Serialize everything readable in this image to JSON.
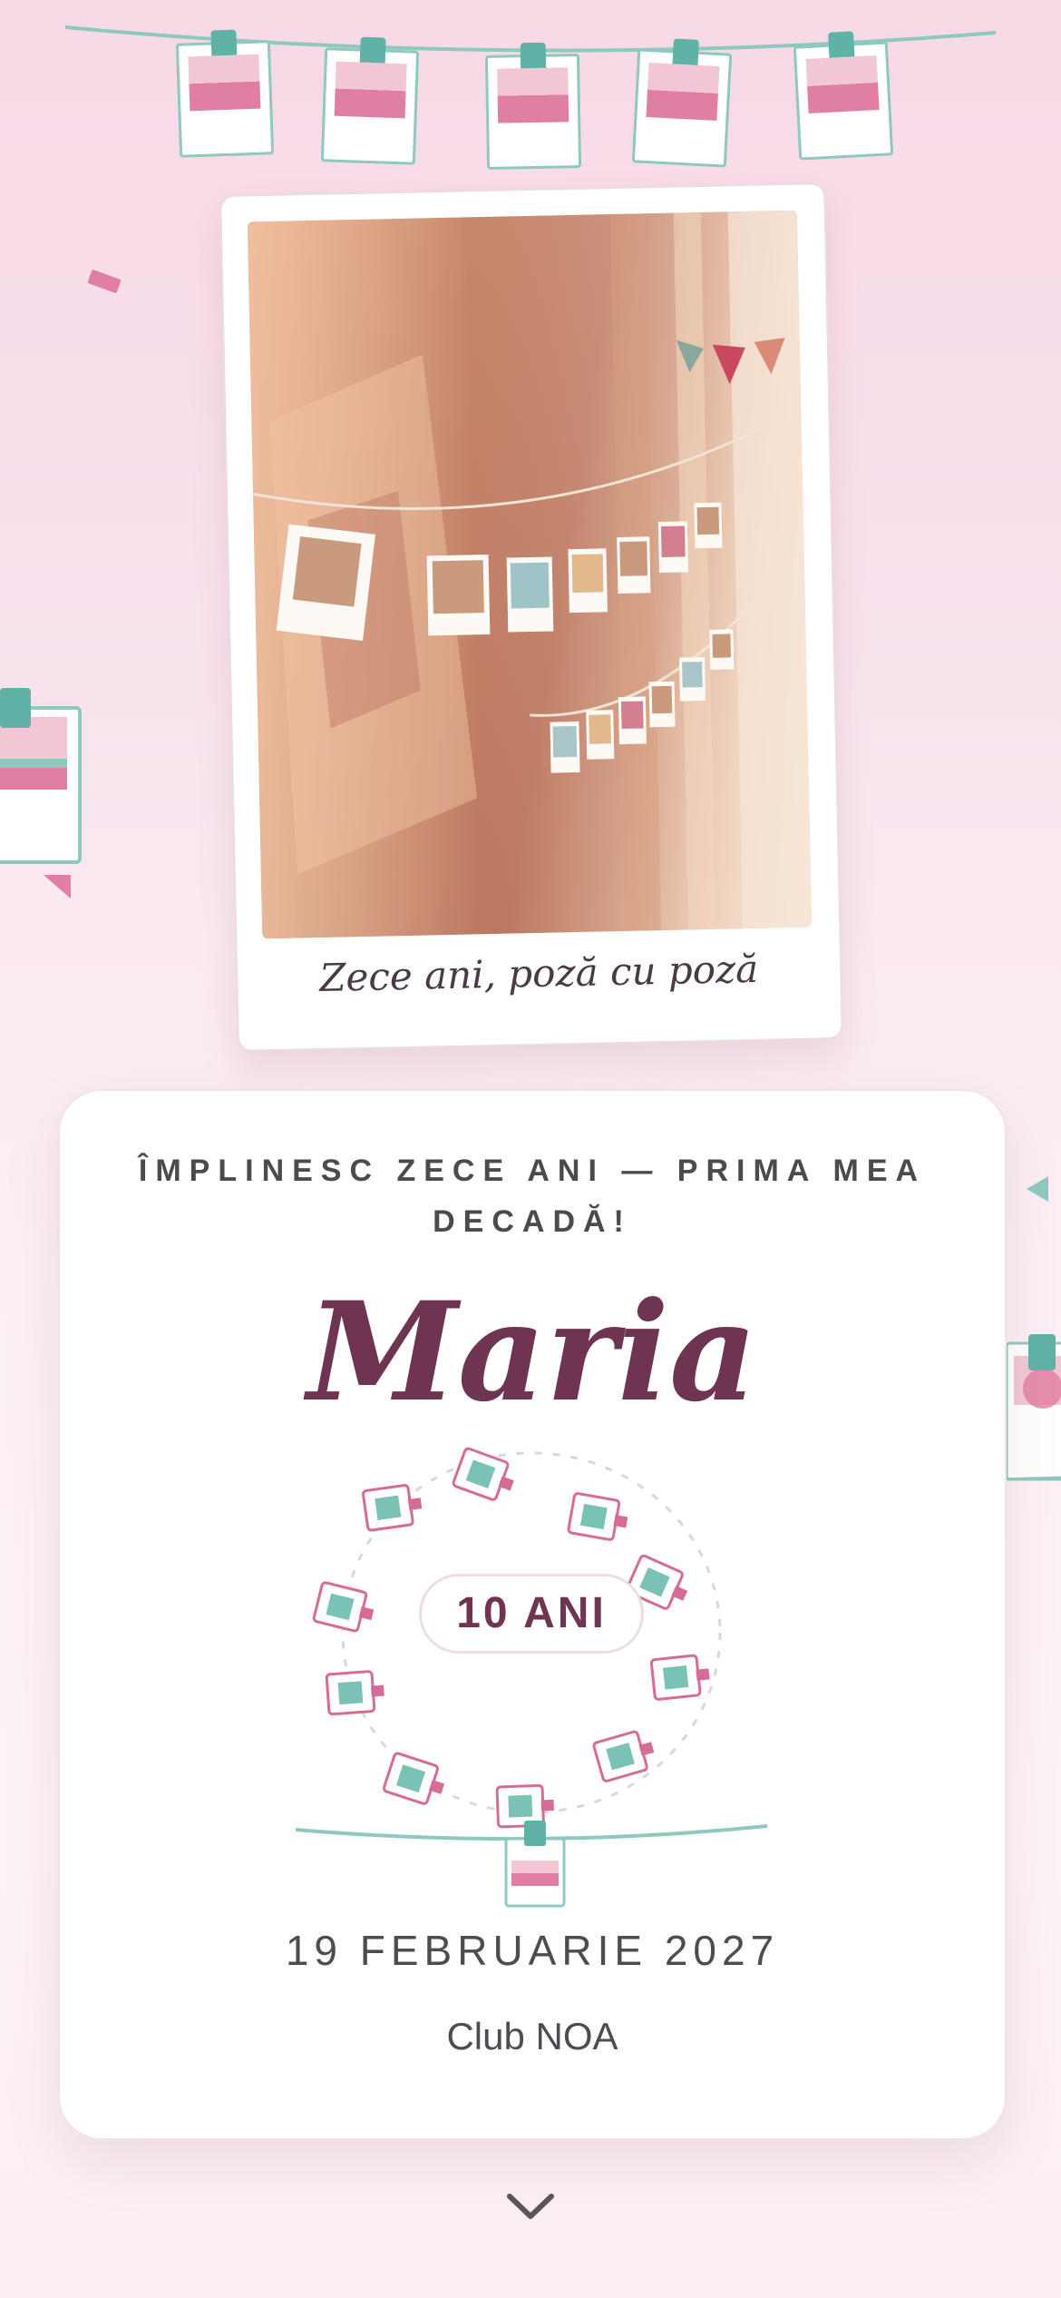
{
  "photo": {
    "caption": "Zece ani, poză cu poză",
    "alt": ""
  },
  "invitation": {
    "eyebrow": "ÎMPLINESC ZECE ANI — PRIMA MEA DECADĂ!",
    "name": "Maria",
    "age_badge": "10 ANI",
    "date": "19 FEBRUARIE 2027",
    "venue": "Club NOA"
  },
  "colors": {
    "accent": "#6e3452",
    "teal": "#5fb3a6",
    "pink": "#e07ea3",
    "background": "#f9e4ee"
  },
  "icons": {
    "scroll": "chevron-down-icon"
  }
}
